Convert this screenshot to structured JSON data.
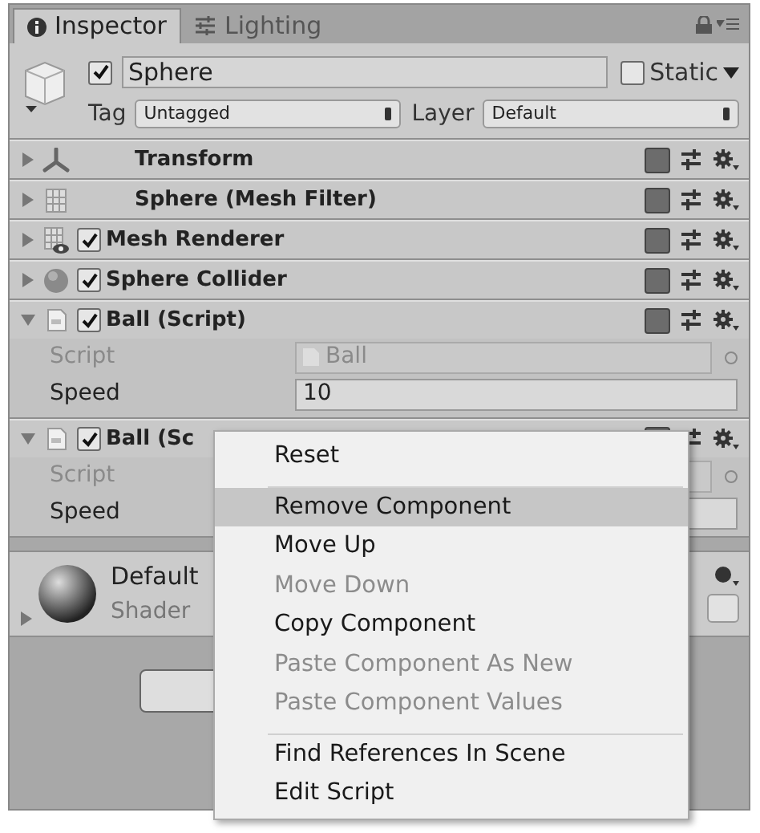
{
  "tabs": [
    {
      "label": "Inspector",
      "selected": true,
      "kind": "info"
    },
    {
      "label": "Lighting",
      "selected": false,
      "kind": "sliders"
    }
  ],
  "object": {
    "active": true,
    "name": "Sphere",
    "static": false,
    "static_label": "Static",
    "tag_label": "Tag",
    "tag": "Untagged",
    "layer_label": "Layer",
    "layer": "Default"
  },
  "components": [
    {
      "name": "Transform",
      "kind": "transform",
      "expanded": false
    },
    {
      "name": "Sphere (Mesh Filter)",
      "kind": "filter",
      "expanded": false
    },
    {
      "name": "Mesh Renderer",
      "kind": "renderer",
      "enabled": true,
      "expanded": false
    },
    {
      "name": "Sphere Collider",
      "kind": "collider",
      "enabled": true,
      "expanded": false
    },
    {
      "name": "Ball (Script)",
      "kind": "script",
      "enabled": true,
      "expanded": true,
      "fields": [
        {
          "label": "Script",
          "value": "Ball",
          "disabled": true,
          "kind": "object"
        },
        {
          "label": "Speed",
          "value": "10",
          "disabled": false,
          "kind": "text"
        }
      ]
    },
    {
      "name": "Ball (Sc",
      "kind": "script",
      "enabled": true,
      "expanded": true,
      "fields": [
        {
          "label": "Script",
          "disabled": true,
          "kind": "object"
        },
        {
          "label": "Speed",
          "disabled": false,
          "kind": "text"
        }
      ]
    }
  ],
  "material": {
    "name": "Default",
    "shader_label": "Shader",
    "expanded": false
  },
  "context_menu": [
    {
      "label": "Reset",
      "disabled": false,
      "selected": false,
      "separator_after": true
    },
    {
      "label": "Remove Component",
      "disabled": false,
      "selected": true,
      "separator_after": false
    },
    {
      "label": "Move Up",
      "disabled": false,
      "selected": false,
      "separator_after": false
    },
    {
      "label": "Move Down",
      "disabled": true,
      "selected": false,
      "separator_after": false
    },
    {
      "label": "Copy Component",
      "disabled": false,
      "selected": false,
      "separator_after": false
    },
    {
      "label": "Paste Component As New",
      "disabled": true,
      "selected": false,
      "separator_after": false
    },
    {
      "label": "Paste Component Values",
      "disabled": true,
      "selected": false,
      "separator_after": true
    },
    {
      "label": "Find References In Scene",
      "disabled": false,
      "selected": false,
      "separator_after": false
    },
    {
      "label": "Edit Script",
      "disabled": false,
      "selected": false,
      "separator_after": false
    }
  ]
}
